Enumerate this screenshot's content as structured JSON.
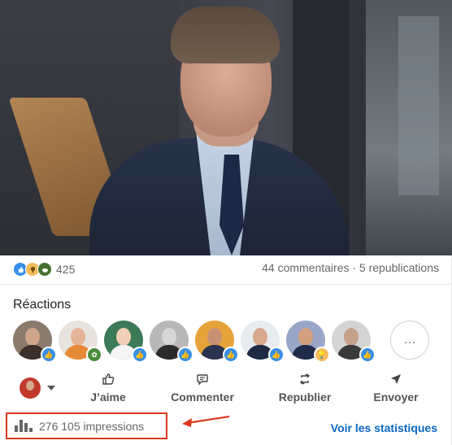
{
  "post": {
    "reactions_count": "425",
    "comments_reposts": "44 commentaires · 5 republications",
    "reaction_icons": [
      "like-icon",
      "insightful-icon",
      "support-icon"
    ]
  },
  "reactions_section": {
    "title": "Réactions",
    "avatars": [
      {
        "name": "reactor-1",
        "badge": "like"
      },
      {
        "name": "reactor-2",
        "badge": "support"
      },
      {
        "name": "reactor-3",
        "badge": "like"
      },
      {
        "name": "reactor-4",
        "badge": "like"
      },
      {
        "name": "reactor-5",
        "badge": "like"
      },
      {
        "name": "reactor-6",
        "badge": "like"
      },
      {
        "name": "reactor-7",
        "badge": "insight"
      },
      {
        "name": "reactor-8",
        "badge": "like"
      }
    ],
    "more_label": "…"
  },
  "actions": {
    "like": "J’aime",
    "comment": "Commenter",
    "repost": "Republier",
    "send": "Envoyer"
  },
  "footer": {
    "impressions": "276 105 impressions",
    "stats_link": "Voir les statistiques"
  },
  "colors": {
    "link_blue": "#0a66c2",
    "highlight_red": "#d93a1e",
    "like_blue": "#378fe9"
  }
}
